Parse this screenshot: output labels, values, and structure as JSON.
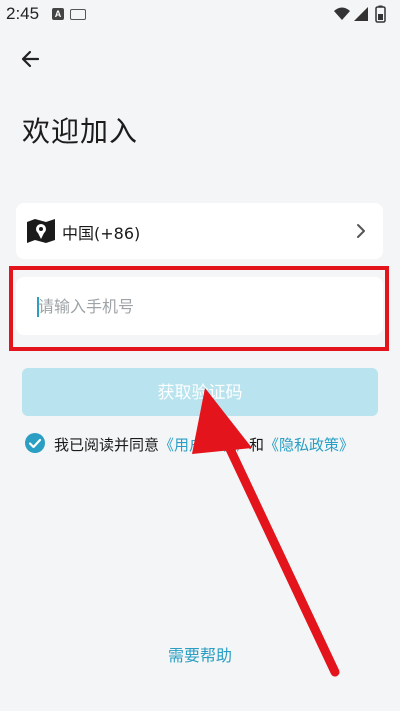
{
  "status_bar": {
    "time": "2:45",
    "notification_letter": "A"
  },
  "page": {
    "title": "欢迎加入"
  },
  "country": {
    "label": "中国(+86)"
  },
  "phone": {
    "placeholder": "请输入手机号",
    "value": ""
  },
  "code_button": {
    "label": "获取验证码"
  },
  "agreement": {
    "checked": true,
    "prefix": "我已阅读并同意",
    "user_agreement": "《用户协议》",
    "conjunction": "和",
    "privacy_policy": "《隐私政策》"
  },
  "help": {
    "label": "需要帮助"
  },
  "colors": {
    "accent": "#2a9ec3",
    "button_disabled": "#b9e3ee",
    "background": "#f3f5f6",
    "annotation_red": "#e3141b"
  },
  "icons": {
    "back": "arrow-left-icon",
    "map": "map-icon",
    "chevron": "chevron-right-icon",
    "check": "checkmark-circle-icon",
    "wifi": "wifi-icon",
    "signal": "signal-icon",
    "battery": "battery-icon"
  }
}
